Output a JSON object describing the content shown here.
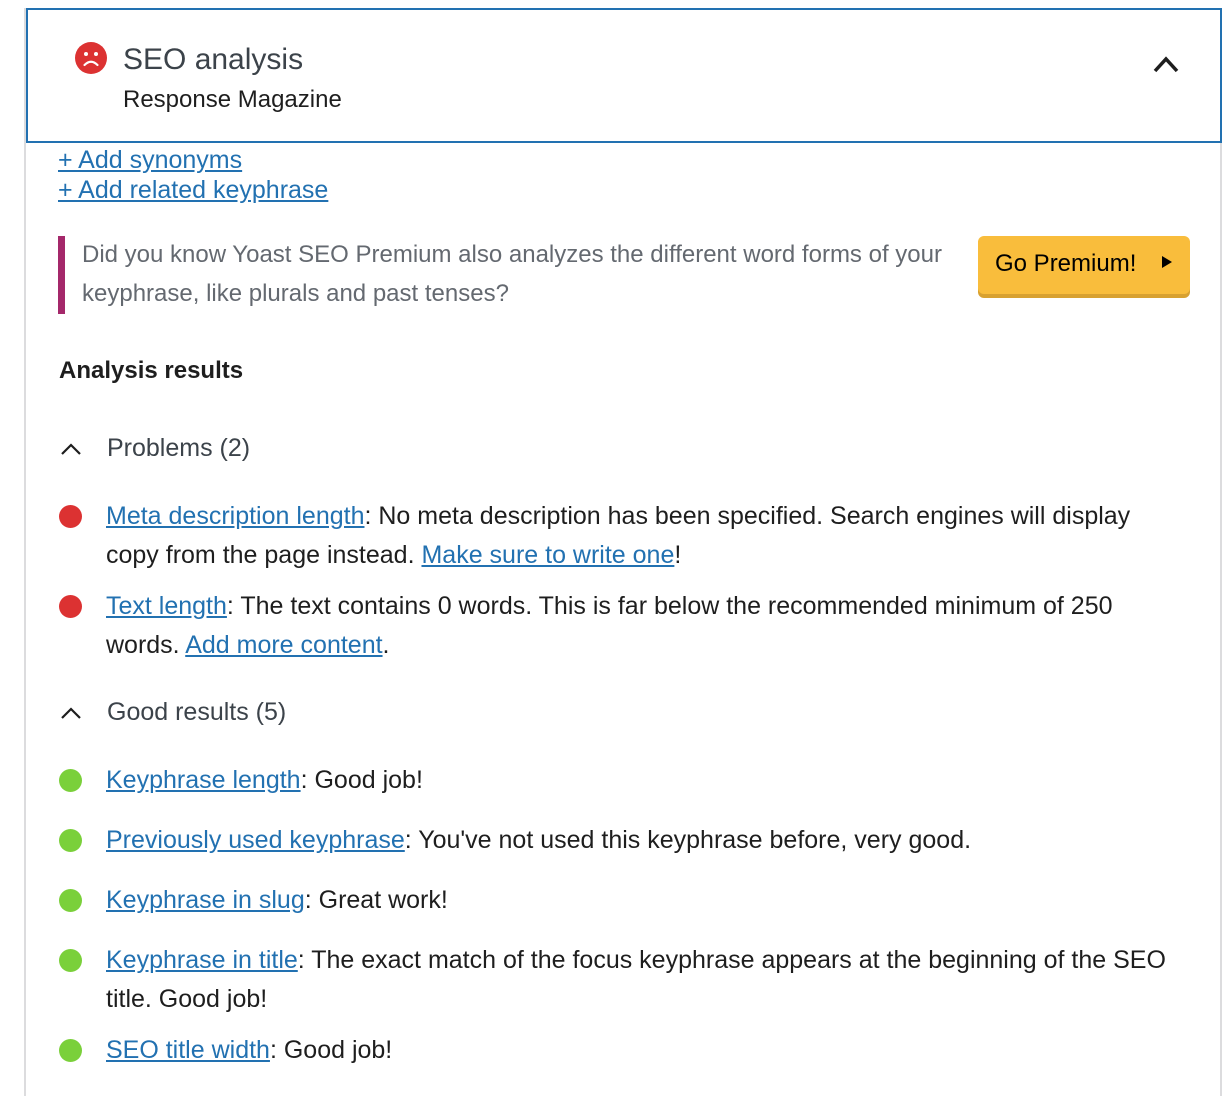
{
  "header": {
    "title": "SEO analysis",
    "subtitle": "Response Magazine",
    "status_icon": "sad-face-icon",
    "status_color": "#dc3232",
    "toggle_icon": "chevron-up-icon"
  },
  "links": {
    "add_synonyms": "+ Add synonyms",
    "add_related": "+ Add related keyphrase"
  },
  "promo": {
    "text": "Did you know Yoast SEO Premium also analyzes the different word forms of your keyphrase, like plurals and past tenses?",
    "button_label": "Go Premium!",
    "accent_color": "#a4286a",
    "button_color": "#f9bd3c"
  },
  "analysis": {
    "title": "Analysis results",
    "problems_label": "Problems (2)",
    "good_label": "Good results (5)",
    "problems": [
      {
        "link": "Meta description length",
        "text": ": No meta description has been specified. Search engines will display copy from the page instead. ",
        "link2": "Make sure to write one",
        "tail": "!"
      },
      {
        "link": "Text length",
        "text": ": The text contains 0 words. This is far below the recommended minimum of 250 words. ",
        "link2": "Add more content",
        "tail": "."
      }
    ],
    "good": [
      {
        "link": "Keyphrase length",
        "text": ": Good job!"
      },
      {
        "link": "Previously used keyphrase",
        "text": ": You've not used this keyphrase before, very good."
      },
      {
        "link": "Keyphrase in slug",
        "text": ": Great work!"
      },
      {
        "link": "Keyphrase in title",
        "text": ": The exact match of the focus keyphrase appears at the beginning of the SEO title. Good job!"
      },
      {
        "link": "SEO title width",
        "text": ": Good job!"
      }
    ]
  }
}
